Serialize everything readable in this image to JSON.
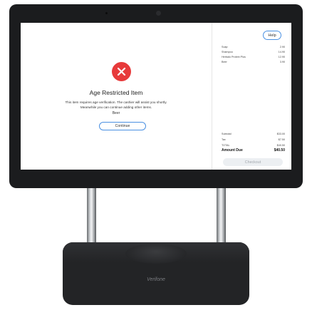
{
  "alert": {
    "title": "Age Restricted Item",
    "message_line1": "This item requires age verification. The cashier will assist you shortly.",
    "message_line2": "Meanwhile you can continue adding other items.",
    "item_name": "Beer",
    "continue_label": "Continue",
    "icon": "close-circle-icon",
    "icon_color": "#e73a3b"
  },
  "header": {
    "help_label": "Help"
  },
  "cart": {
    "items": [
      {
        "name": "Soap",
        "price": "2.90"
      },
      {
        "name": "Shampoo",
        "price": "14.90"
      },
      {
        "name": "Herbalo Protein Plus",
        "price": "12.90"
      },
      {
        "name": "Beer",
        "price": "3.90"
      }
    ]
  },
  "totals": {
    "subtotal_label": "Subtotal",
    "subtotal_value": "$33.00",
    "tax_label": "Tax",
    "tax_value": "$7.50",
    "total_label": "TOTAL",
    "total_value": "$40.50",
    "amount_due_label": "Amount Due",
    "amount_due_value": "$40.50"
  },
  "checkout_label": "Checkout",
  "device": {
    "brand": "Verifone"
  },
  "colors": {
    "accent": "#4a90e2",
    "error": "#e73a3b",
    "bezel": "#1b1c1e"
  }
}
